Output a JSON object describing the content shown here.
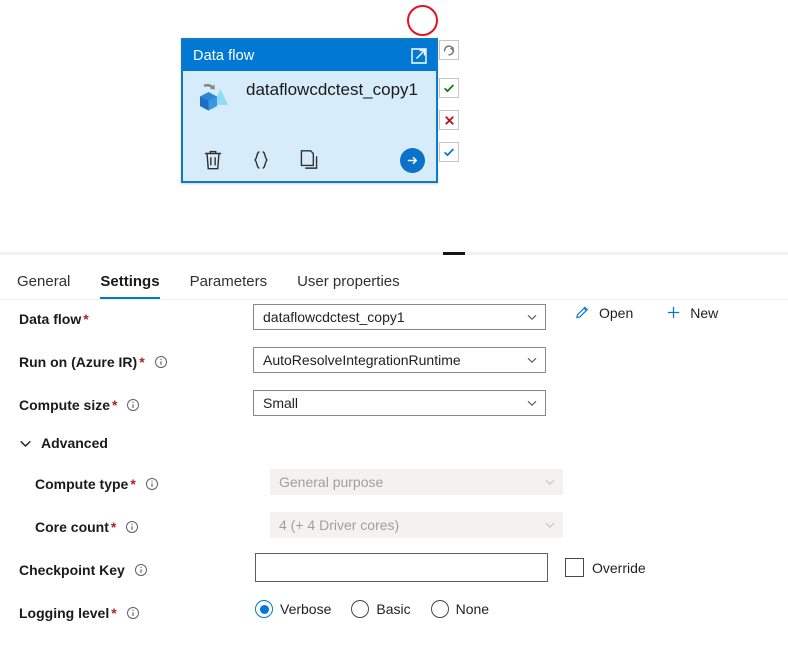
{
  "canvas": {
    "annotation": {
      "shape": "circle",
      "color": "#e81123"
    },
    "node": {
      "header_title": "Data flow",
      "expand_icon": "open-in-new-icon",
      "name": "dataflowcdctest_copy1",
      "type_icon": "dataflow-icon",
      "actions": [
        {
          "name": "delete-icon",
          "glyph": "trash"
        },
        {
          "name": "code-braces-icon",
          "glyph": "{}"
        },
        {
          "name": "duplicate-icon",
          "glyph": "copy"
        }
      ],
      "run_button_icon": "arrow-right-icon",
      "header_color": "#0078d4",
      "body_color": "#d6ecfa",
      "border_color": "#0f7bc4"
    },
    "status_icons": [
      {
        "name": "status-retry-icon",
        "glyph": "retry",
        "color": "#797775"
      },
      {
        "name": "status-success-icon",
        "glyph": "check",
        "color": "#107c10"
      },
      {
        "name": "status-failure-icon",
        "glyph": "cross",
        "color": "#c50f1f"
      },
      {
        "name": "status-completion-icon",
        "glyph": "check",
        "color": "#0078d4"
      }
    ]
  },
  "tabs": [
    {
      "label": "General",
      "active": false
    },
    {
      "label": "Settings",
      "active": true
    },
    {
      "label": "Parameters",
      "active": false
    },
    {
      "label": "User properties",
      "active": false
    }
  ],
  "settings": {
    "data_flow": {
      "label": "Data flow",
      "required": true,
      "value": "dataflowcdctest_copy1",
      "open_label": "Open",
      "new_label": "New"
    },
    "run_on": {
      "label": "Run on (Azure IR)",
      "required": true,
      "value": "AutoResolveIntegrationRuntime"
    },
    "compute_size": {
      "label": "Compute size",
      "required": true,
      "value": "Small"
    },
    "advanced": {
      "label": "Advanced",
      "expanded": true,
      "compute_type": {
        "label": "Compute type",
        "required": true,
        "value": "General purpose",
        "disabled": true
      },
      "core_count": {
        "label": "Core count",
        "required": true,
        "value": "4 (+ 4 Driver cores)",
        "disabled": true
      }
    },
    "checkpoint_key": {
      "label": "Checkpoint Key",
      "required": false,
      "value": "",
      "placeholder": "",
      "override_label": "Override",
      "override_checked": false
    },
    "logging_level": {
      "label": "Logging level",
      "required": true,
      "options": [
        {
          "label": "Verbose",
          "selected": true
        },
        {
          "label": "Basic",
          "selected": false
        },
        {
          "label": "None",
          "selected": false
        }
      ]
    }
  },
  "colors": {
    "accent": "#0078d4",
    "required_asterisk": "#a4262c",
    "success": "#107c10",
    "error": "#c50f1f"
  }
}
